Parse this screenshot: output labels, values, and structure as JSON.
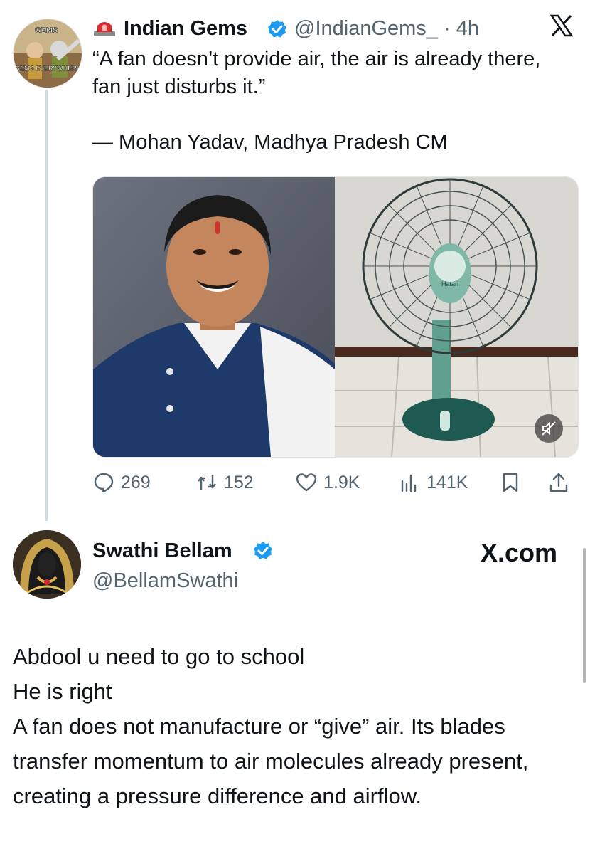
{
  "tweet": {
    "avatar": {
      "top_text": "GEMS",
      "bottom_text": "GEMS EVERYWHERE"
    },
    "author_name": "Indian Gems",
    "handle_time": "@IndianGems_ · 4h",
    "text": "“A fan doesn’t provide air, the air is already there, fan just disturbs it.”\n\n— Mohan Yadav, Madhya Pradesh CM",
    "media": {
      "left_image": "portrait of smiling man in blue nehru jacket",
      "right_image": "pedestal fan in green and teal colors",
      "fan_label": "Hatari"
    },
    "actions": {
      "replies": "269",
      "reposts": "152",
      "likes": "1.9K",
      "views": "141K"
    }
  },
  "reply": {
    "author_name": "Swathi Bellam",
    "handle": "@BellamSwathi",
    "watermark": "X.com",
    "text": "Abdool u need to go to school\nHe is right\nA fan does not manufacture or “give” air. Its blades transfer momentum to air molecules already present, creating a pressure difference and airflow."
  },
  "colors": {
    "verified": "#1d9bf0",
    "secondary_text": "#536471",
    "thread_line": "#cfd9de"
  },
  "icons": [
    "siren-icon",
    "verified-icon",
    "x-logo-icon",
    "reply-icon",
    "repost-icon",
    "like-icon",
    "views-icon",
    "bookmark-icon",
    "share-icon",
    "mute-icon"
  ]
}
